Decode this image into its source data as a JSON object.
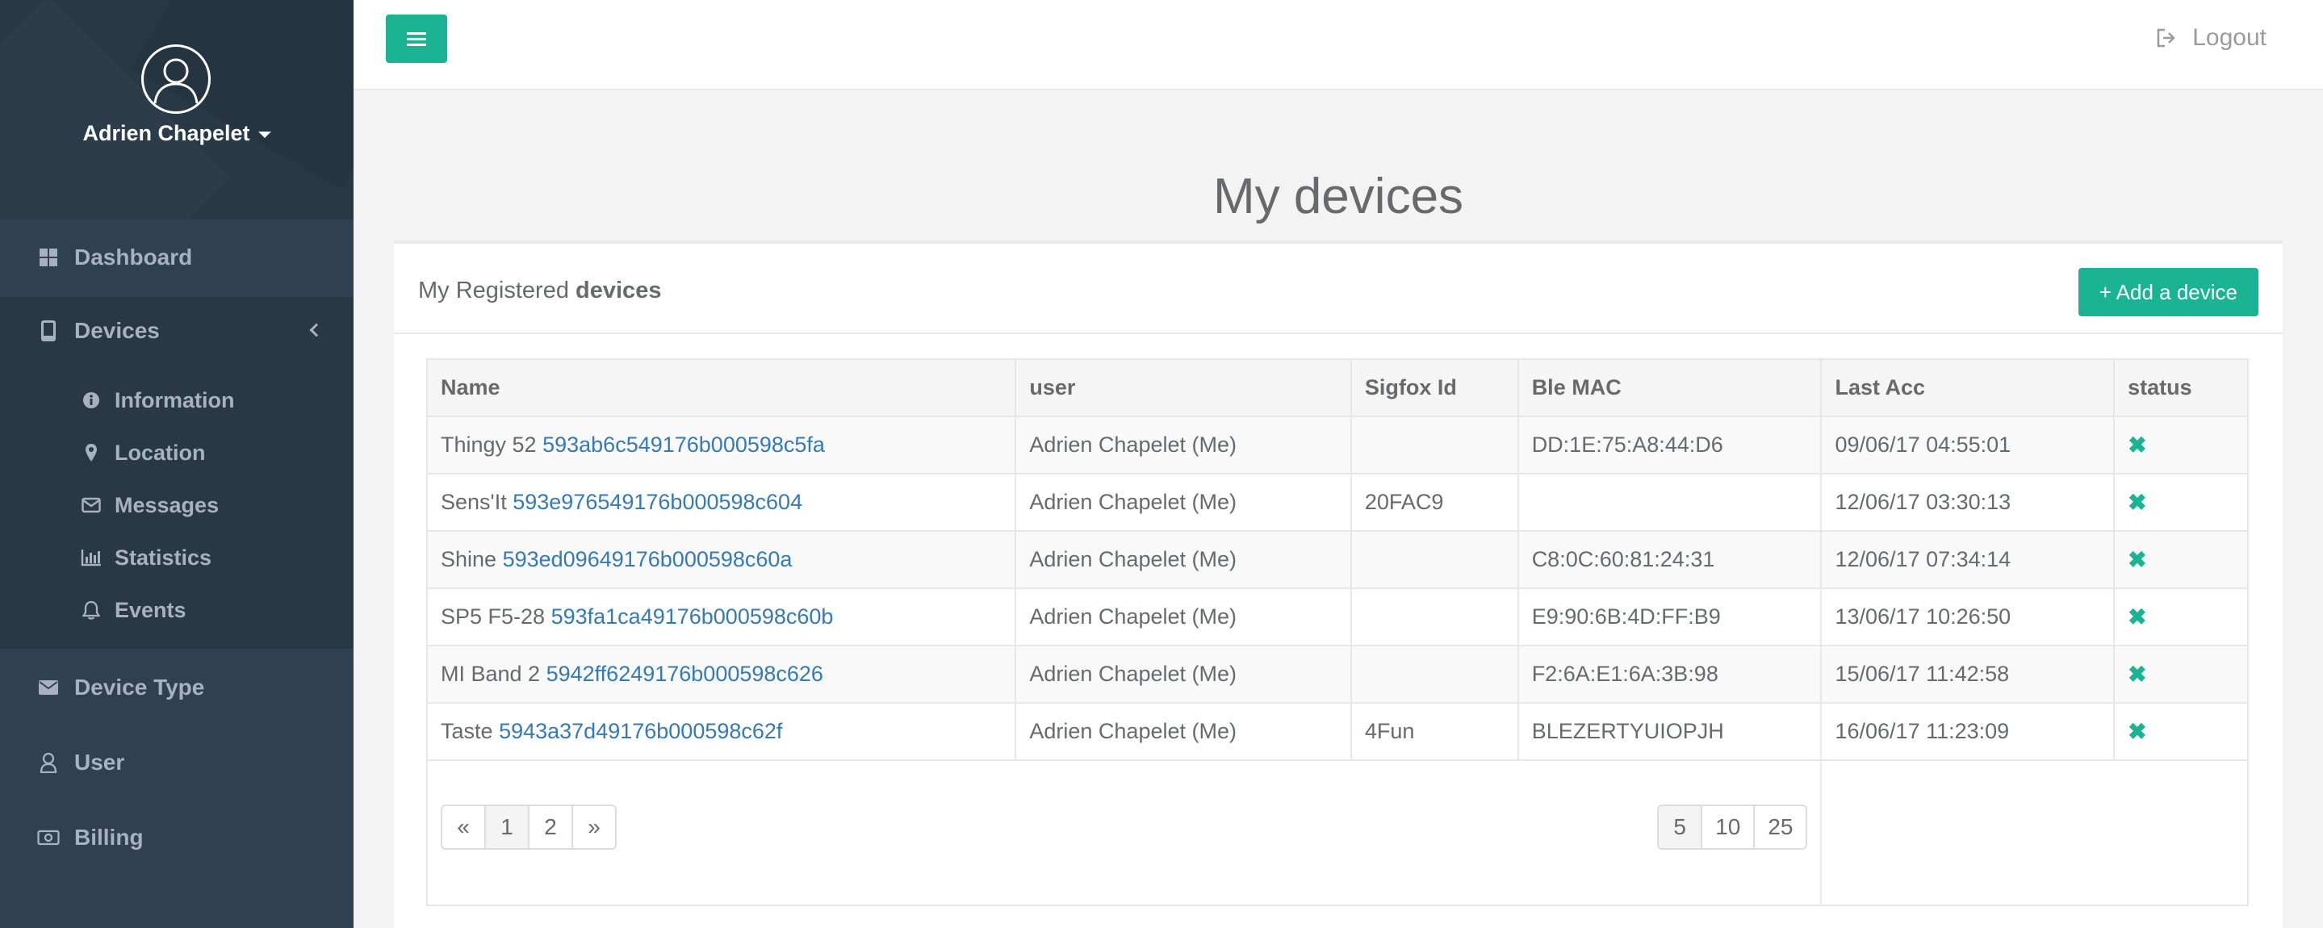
{
  "profile": {
    "name": "Adrien Chapelet"
  },
  "sidebar": {
    "items": [
      {
        "label": "Dashboard",
        "icon": "dashboard-icon"
      },
      {
        "label": "Devices",
        "icon": "device-icon"
      },
      {
        "label": "Device Type",
        "icon": "envelope-icon"
      },
      {
        "label": "User",
        "icon": "user-icon"
      },
      {
        "label": "Billing",
        "icon": "money-icon"
      }
    ],
    "submenu": [
      {
        "label": "Information",
        "icon": "info-icon"
      },
      {
        "label": "Location",
        "icon": "map-marker-icon"
      },
      {
        "label": "Messages",
        "icon": "envelope-open-icon"
      },
      {
        "label": "Statistics",
        "icon": "bar-chart-icon"
      },
      {
        "label": "Events",
        "icon": "bell-icon"
      }
    ]
  },
  "topbar": {
    "logout_label": "Logout"
  },
  "page": {
    "title": "My devices"
  },
  "panel": {
    "title_prefix": "My Registered",
    "title_bold": "devices",
    "add_button": "+ Add a device"
  },
  "table": {
    "headers": [
      "Name",
      "user",
      "Sigfox Id",
      "Ble MAC",
      "Last Acc",
      "status"
    ],
    "rows": [
      {
        "name": "Thingy 52",
        "id": "593ab6c549176b000598c5fa",
        "user": "Adrien Chapelet (Me)",
        "sigfox": "",
        "ble": "DD:1E:75:A8:44:D6",
        "last": "09/06/17 04:55:01",
        "status": "✖"
      },
      {
        "name": "Sens'It",
        "id": "593e976549176b000598c604",
        "user": "Adrien Chapelet (Me)",
        "sigfox": "20FAC9",
        "ble": "",
        "last": "12/06/17 03:30:13",
        "status": "✖"
      },
      {
        "name": "Shine",
        "id": "593ed09649176b000598c60a",
        "user": "Adrien Chapelet (Me)",
        "sigfox": "",
        "ble": "C8:0C:60:81:24:31",
        "last": "12/06/17 07:34:14",
        "status": "✖"
      },
      {
        "name": "SP5 F5-28",
        "id": "593fa1ca49176b000598c60b",
        "user": "Adrien Chapelet (Me)",
        "sigfox": "",
        "ble": "E9:90:6B:4D:FF:B9",
        "last": "13/06/17 10:26:50",
        "status": "✖"
      },
      {
        "name": "MI Band 2",
        "id": "5942ff6249176b000598c626",
        "user": "Adrien Chapelet (Me)",
        "sigfox": "",
        "ble": "F2:6A:E1:6A:3B:98",
        "last": "15/06/17 11:42:58",
        "status": "✖"
      },
      {
        "name": "Taste",
        "id": "5943a37d49176b000598c62f",
        "user": "Adrien Chapelet (Me)",
        "sigfox": "4Fun",
        "ble": "BLEZERTYUIOPJH",
        "last": "16/06/17 11:23:09",
        "status": "✖"
      }
    ]
  },
  "pagination": {
    "pages": [
      "«",
      "1",
      "2",
      "»"
    ],
    "page_sizes": [
      "5",
      "10",
      "25"
    ]
  },
  "colors": {
    "accent": "#1ab394",
    "sidebar": "#2f4050",
    "link": "#337ab7"
  }
}
